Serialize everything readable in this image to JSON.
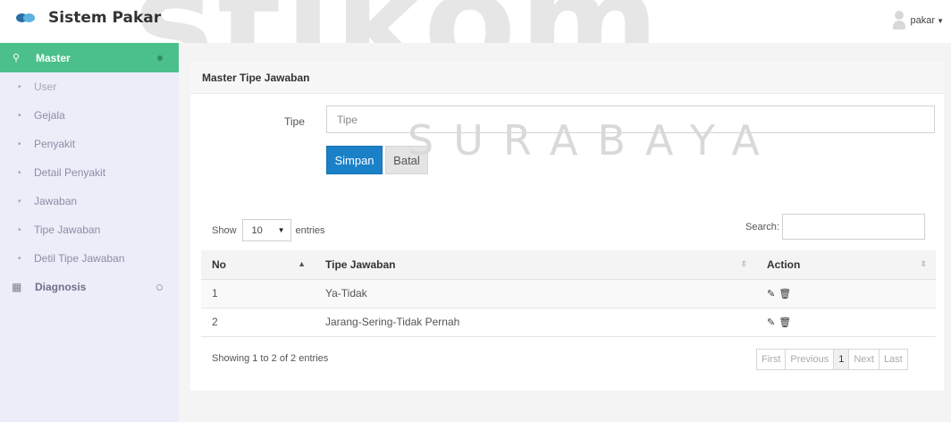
{
  "watermark": {
    "big": "stikom",
    "small": "SURABAYA"
  },
  "app": {
    "title": "Sistem Pakar",
    "user": "pakar"
  },
  "sidebar": {
    "master": {
      "label": "Master",
      "icon": "sliders-icon"
    },
    "items": [
      {
        "label": "User"
      },
      {
        "label": "Gejala"
      },
      {
        "label": "Penyakit"
      },
      {
        "label": "Detail Penyakit"
      },
      {
        "label": "Jawaban"
      },
      {
        "label": "Tipe Jawaban"
      },
      {
        "label": "Detil Tipe Jawaban"
      }
    ],
    "diagnosis": {
      "label": "Diagnosis",
      "icon": "grid-icon"
    }
  },
  "panel": {
    "title": "Master Tipe Jawaban"
  },
  "form": {
    "tipe_label": "Tipe",
    "tipe_placeholder": "Tipe",
    "save_label": "Simpan",
    "cancel_label": "Batal"
  },
  "table_controls": {
    "show_prefix": "Show",
    "show_value": "10",
    "show_suffix": "entries",
    "search_label": "Search:"
  },
  "table": {
    "columns": [
      "No",
      "Tipe Jawaban",
      "Action"
    ],
    "rows": [
      {
        "no": "1",
        "tipe": "Ya-Tidak"
      },
      {
        "no": "2",
        "tipe": "Jarang-Sering-Tidak Pernah"
      }
    ]
  },
  "footer": {
    "info": "Showing 1 to 2 of 2 entries",
    "pager": [
      "First",
      "Previous",
      "1",
      "Next",
      "Last"
    ]
  },
  "colors": {
    "accent_green": "#4cc08c",
    "primary_blue": "#1a81c9",
    "sidebar_bg": "#ecedf8"
  }
}
